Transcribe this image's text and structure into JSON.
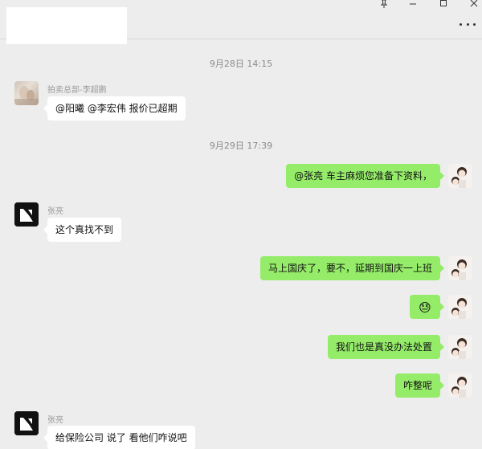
{
  "window": {
    "pin_icon": "pin-icon",
    "minimize_icon": "minimize-icon",
    "maximize_icon": "maximize-icon",
    "close_icon": "close-icon",
    "more_icon": "more-icon"
  },
  "colors": {
    "background": "#ededed",
    "incoming_bubble": "#ffffff",
    "outgoing_bubble": "#95ec69",
    "timestamp_text": "#8a8a8a",
    "sender_text": "#9a9a9a"
  },
  "timestamps": [
    "9月28日 14:15",
    "9月29日 17:39"
  ],
  "messages": [
    {
      "direction": "in",
      "sender": "拍卖总部-李超鹏",
      "text": "@阳曦  @李宏伟 报价已超期",
      "avatar": "photo-avatar"
    },
    {
      "direction": "out",
      "text": "@张亮 车主麻烦您准备下资料，",
      "avatar": "girl-avatar"
    },
    {
      "direction": "in",
      "sender": "张亮",
      "text": "这个真找不到",
      "avatar": "logo-avatar"
    },
    {
      "direction": "out",
      "text": "马上国庆了，要不，延期到国庆一上班",
      "avatar": "girl-avatar"
    },
    {
      "direction": "out",
      "text": "😓",
      "avatar": "girl-avatar"
    },
    {
      "direction": "out",
      "text": "我们也是真没办法处置",
      "avatar": "girl-avatar"
    },
    {
      "direction": "out",
      "text": "咋整呢",
      "avatar": "girl-avatar"
    },
    {
      "direction": "in",
      "sender": "张亮",
      "text": "给保险公司 说了 看他们咋说吧",
      "avatar": "logo-avatar"
    }
  ]
}
